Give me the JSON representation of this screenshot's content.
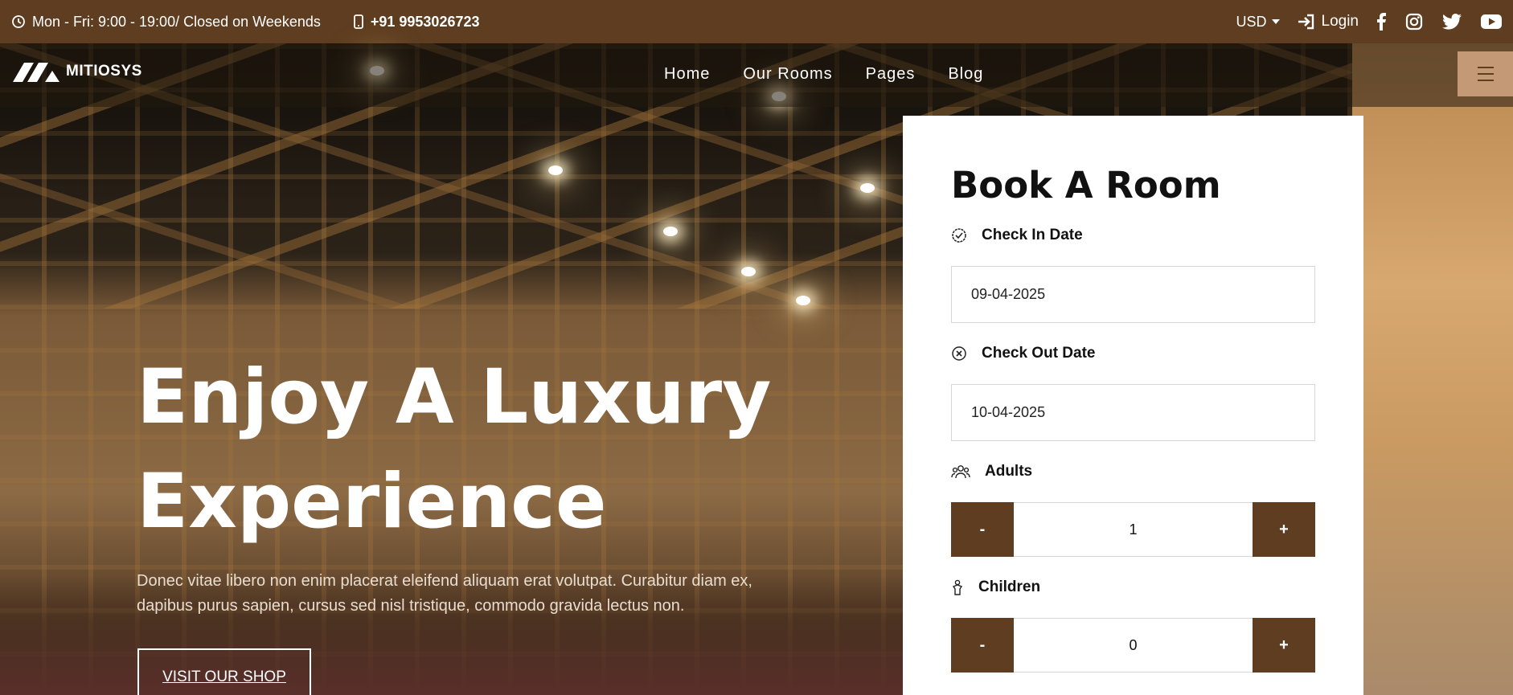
{
  "topbar": {
    "hours": "Mon - Fri: 9:00 - 19:00/ Closed on Weekends",
    "phone": "+91 9953026723",
    "currency": "USD",
    "login": "Login",
    "social": [
      "facebook-icon",
      "instagram-icon",
      "twitter-icon",
      "youtube-icon"
    ]
  },
  "brand": {
    "name": "MITIOSYS"
  },
  "nav": {
    "items": [
      "Home",
      "Our Rooms",
      "Pages",
      "Blog"
    ]
  },
  "hero": {
    "headline_line1": "Enjoy A Luxury",
    "headline_line2": "Experience",
    "subtext": "Donec vitae libero non enim placerat eleifend aliquam erat volutpat. Curabitur diam ex, dapibus purus sapien, cursus sed nisl tristique, commodo gravida lectus non.",
    "cta": "VISIT OUR SHOP"
  },
  "booking": {
    "title": "Book A Room",
    "check_in_label": "Check In Date",
    "check_in_value": "09-04-2025",
    "check_out_label": "Check Out Date",
    "check_out_value": "10-04-2025",
    "adults_label": "Adults",
    "adults_value": "1",
    "children_label": "Children",
    "children_value": "0",
    "minus": "-",
    "plus": "+"
  },
  "colors": {
    "brand_brown": "#5e3d20",
    "menu_tan": "#c39a75"
  }
}
